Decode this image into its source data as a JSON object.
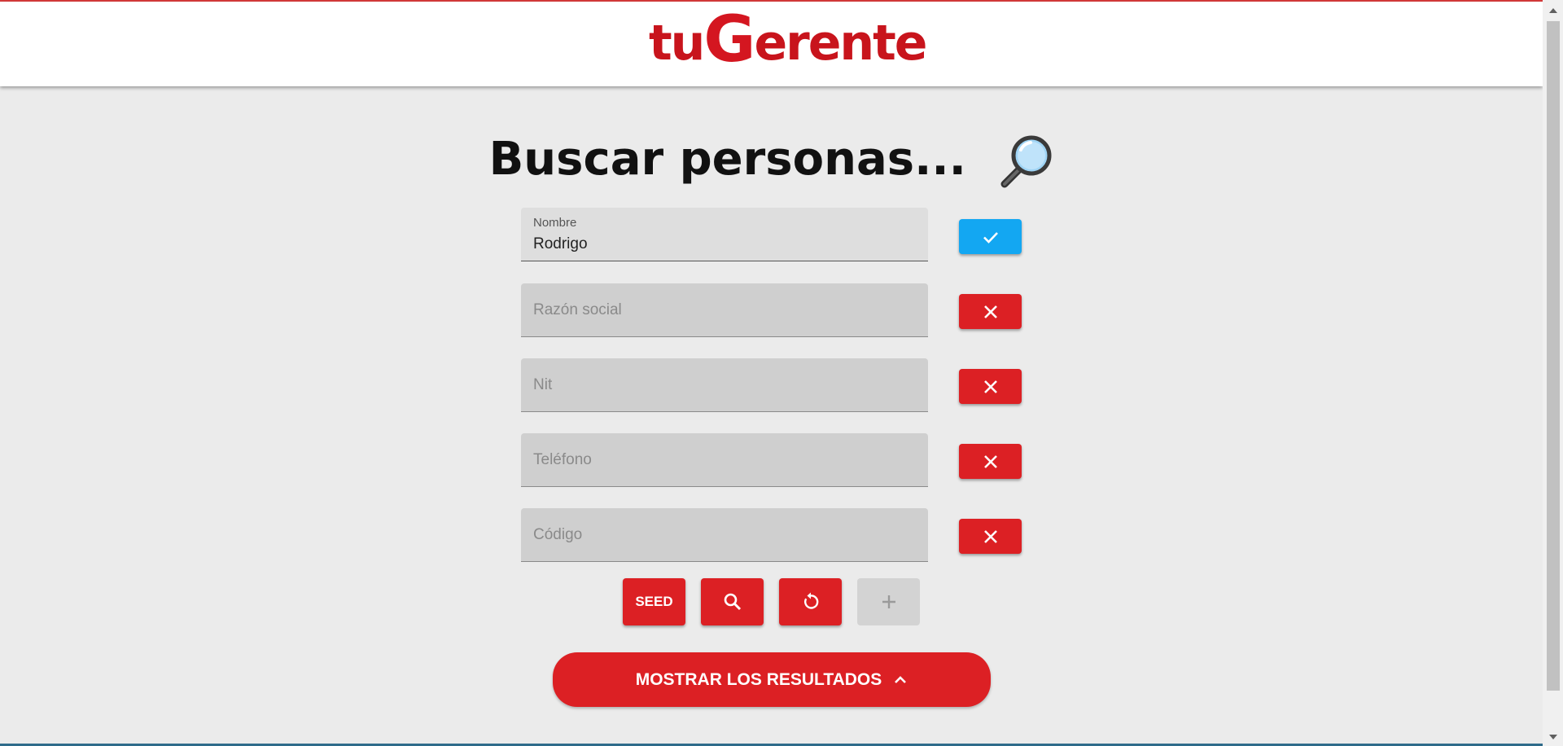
{
  "header": {
    "logo_part1": "tu",
    "logo_part2": "G",
    "logo_part3": "erente"
  },
  "title": "Buscar personas...",
  "fields": [
    {
      "label": "Nombre",
      "value": "Rodrigo",
      "placeholder": ""
    },
    {
      "label": "",
      "value": "",
      "placeholder": "Razón social"
    },
    {
      "label": "",
      "value": "",
      "placeholder": "Nit"
    },
    {
      "label": "",
      "value": "",
      "placeholder": "Teléfono"
    },
    {
      "label": "",
      "value": "",
      "placeholder": "Código"
    }
  ],
  "actions": {
    "seed_label": "SEED",
    "search_icon": "search-icon",
    "reset_icon": "reset-icon",
    "add_icon": "plus-icon"
  },
  "results_button": "MOSTRAR LOS RESULTADOS",
  "colors": {
    "brand_red": "#dc2024",
    "accent_blue": "#13a7f2",
    "background": "#ebebeb"
  }
}
